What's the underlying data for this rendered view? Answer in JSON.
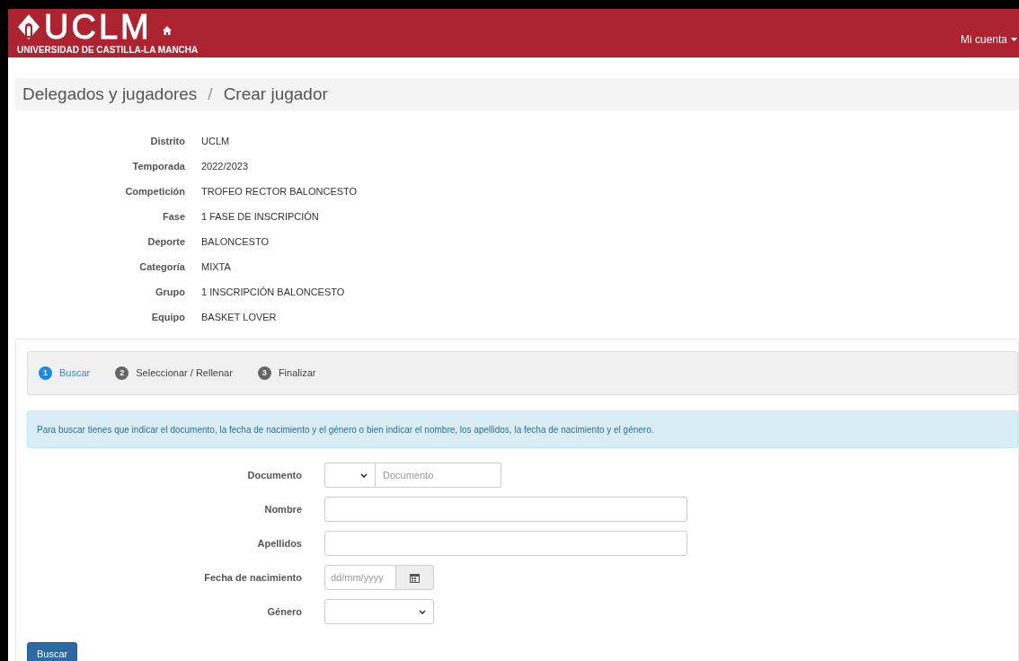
{
  "header": {
    "logo_text": "UCLM",
    "logo_subtitle": "UNIVERSIDAD DE CASTILLA-LA MANCHA",
    "account_menu": "Mi cuenta"
  },
  "breadcrumb": [
    "Delegados y jugadores",
    "Crear jugador"
  ],
  "breadcrumb_separator": "/",
  "details": [
    {
      "label": "Distrito",
      "value": "UCLM"
    },
    {
      "label": "Temporada",
      "value": "2022/2023"
    },
    {
      "label": "Competición",
      "value": "TROFEO RECTOR BALONCESTO"
    },
    {
      "label": "Fase",
      "value": "1 FASE DE INSCRIPCIÓN"
    },
    {
      "label": "Deporte",
      "value": "BALONCESTO"
    },
    {
      "label": "Categoría",
      "value": "MIXTA"
    },
    {
      "label": "Grupo",
      "value": "1 INSCRIPCIÓN BALONCESTO"
    },
    {
      "label": "Equipo",
      "value": "BASKET LOVER"
    }
  ],
  "steps": [
    {
      "number": "1",
      "label": "Buscar",
      "selected": true
    },
    {
      "number": "2",
      "label": "Seleccionar / Rellenar",
      "selected": false
    },
    {
      "number": "3",
      "label": "Finalizar",
      "selected": false
    }
  ],
  "info_message": "Para buscar tienes que indicar el documento, la fecha de nacimiento y el género o bien indicar el nombre, los apellidos, la fecha de nacimiento y el género.",
  "form": [
    {
      "kind": "document",
      "label": "Documento",
      "placeholder": "Documento"
    },
    {
      "kind": "text",
      "label": "Nombre"
    },
    {
      "kind": "text",
      "label": "Apellidos"
    },
    {
      "kind": "date",
      "label": "Fecha de nacimiento",
      "placeholder": "dd/mm/yyyy"
    },
    {
      "kind": "select",
      "label": "Género"
    }
  ],
  "submit_button": "Buscar"
}
